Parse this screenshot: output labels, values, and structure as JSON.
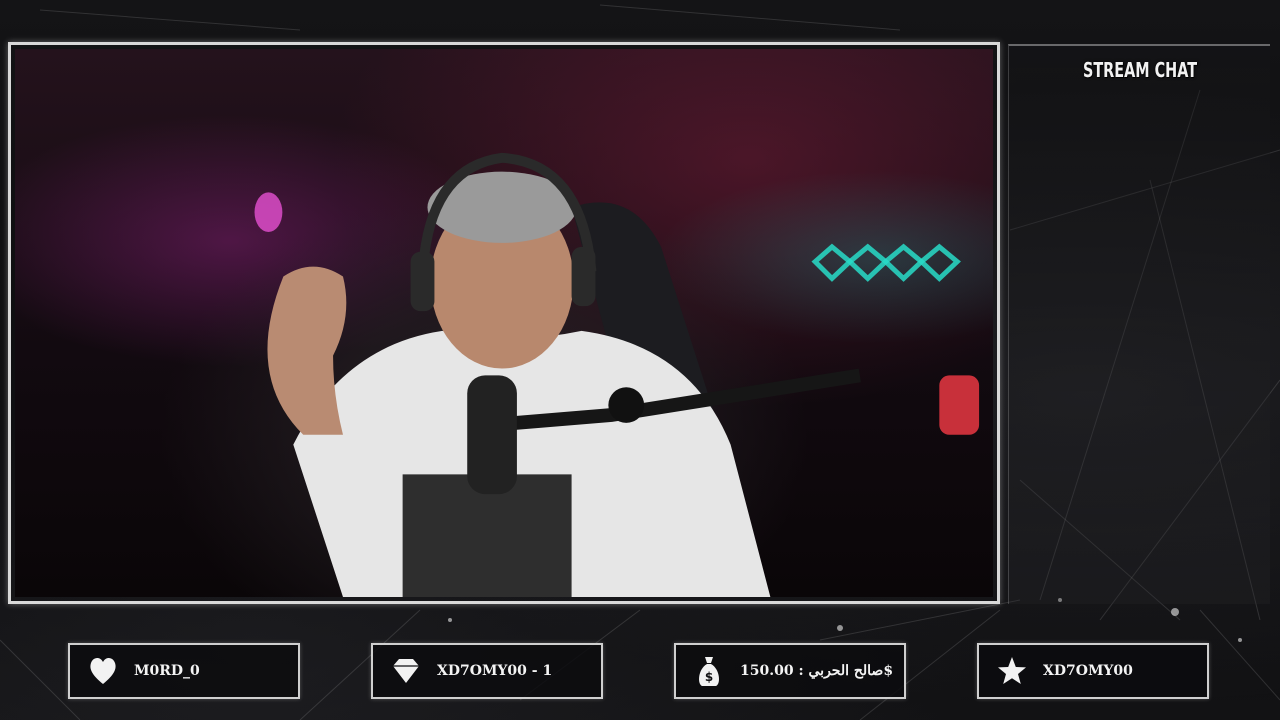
{
  "chat": {
    "title": "STREAM CHAT"
  },
  "events": {
    "follower": {
      "icon": "heart-icon",
      "text": "M0RD_0"
    },
    "subscriber": {
      "icon": "diamond-icon",
      "text": "XD7OMY00 - 1"
    },
    "donation": {
      "icon": "money-bag-icon",
      "text": "صالح الحربي : 150.00$"
    },
    "latest": {
      "icon": "star-icon",
      "text": "XD7OMY00"
    }
  },
  "colors": {
    "frame": "#d9d9d9",
    "text": "#f4f4f4",
    "background": "#0b0b0d"
  }
}
